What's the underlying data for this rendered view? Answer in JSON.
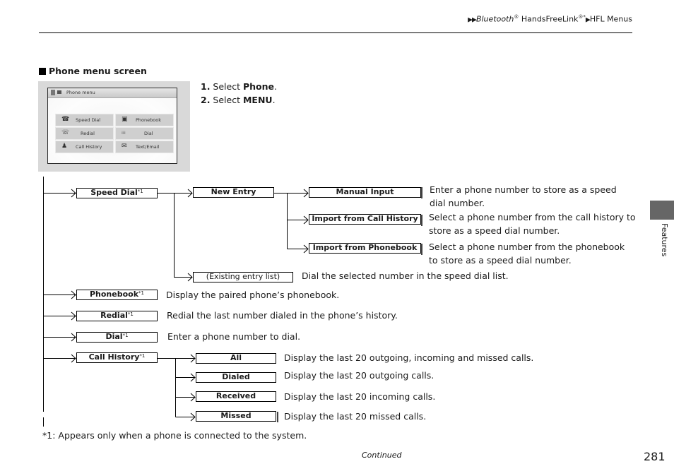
{
  "header": {
    "breadcrumb": {
      "prefix_arrows": "▶▶",
      "part1_italic": "Bluetooth",
      "part1_reg": "®",
      "part2": " HandsFreeLink",
      "part2_mark": "®*",
      "sep_arrow": "▶",
      "part3": "HFL Menus"
    }
  },
  "section": {
    "title": "Phone menu screen",
    "steps": [
      {
        "num": "1.",
        "pre": " Select ",
        "bold": "Phone",
        "post": "."
      },
      {
        "num": "2.",
        "pre": " Select ",
        "bold": "MENU",
        "post": "."
      }
    ]
  },
  "screenshot": {
    "title": "Phone menu",
    "buttons": [
      {
        "label": "Speed Dial",
        "icon": "speed-dial-icon",
        "glyph": "☎"
      },
      {
        "label": "Phonebook",
        "icon": "phonebook-icon",
        "glyph": "▣"
      },
      {
        "label": "Redial",
        "icon": "redial-icon",
        "glyph": "☏"
      },
      {
        "label": "Dial",
        "icon": "dialpad-icon",
        "glyph": "⁞⁞⁞"
      },
      {
        "label": "Call History",
        "icon": "call-history-icon",
        "glyph": "♟"
      },
      {
        "label": "Text/Email",
        "icon": "envelope-icon",
        "glyph": "✉"
      }
    ]
  },
  "diagram": {
    "footnote_mark": "*1",
    "speed_dial": {
      "label": "Speed Dial",
      "new_entry": {
        "label": "New Entry",
        "children": [
          {
            "label": "Manual Input",
            "desc": [
              "Enter a phone number to store as a speed",
              "dial number."
            ]
          },
          {
            "label": "Import from Call History",
            "desc": [
              "Select a phone number from the call history to",
              "store as a speed dial number."
            ]
          },
          {
            "label": "Import from Phonebook",
            "desc": [
              "Select a phone number from the phonebook",
              "to store as a speed dial number."
            ]
          }
        ]
      },
      "existing": {
        "label": "(Existing entry list)",
        "desc": "Dial the selected number in the speed dial list."
      }
    },
    "phonebook": {
      "label": "Phonebook",
      "desc": "Display the paired phone’s phonebook."
    },
    "redial": {
      "label": "Redial",
      "desc": "Redial the last number dialed in the phone’s history."
    },
    "dial": {
      "label": "Dial",
      "desc": "Enter a phone number to dial."
    },
    "call_history": {
      "label": "Call History",
      "children": [
        {
          "label": "All",
          "desc": "Display the last 20 outgoing, incoming and missed calls."
        },
        {
          "label": "Dialed",
          "desc": "Display the last 20 outgoing calls."
        },
        {
          "label": "Received",
          "desc": "Display the last 20 incoming calls."
        },
        {
          "label": "Missed",
          "desc": "Display the last 20 missed calls."
        }
      ]
    }
  },
  "footer": {
    "footnote": "*1: Appears only when a phone is connected to the system.",
    "continued": "Continued",
    "page_number": "281",
    "side_tab": "Features",
    "side_tab_color": "#666666"
  }
}
